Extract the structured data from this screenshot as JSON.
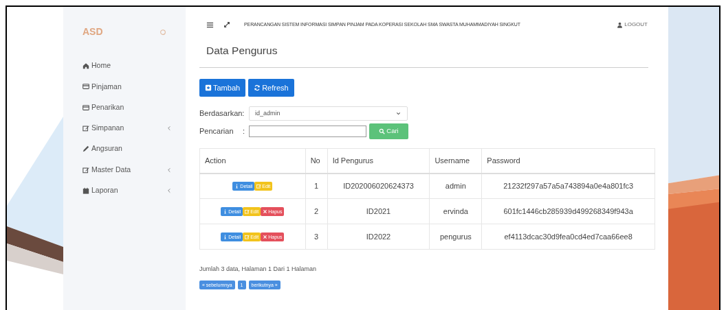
{
  "sidebar": {
    "brand": "ASD",
    "items": [
      {
        "label": "Home",
        "has_submenu": false
      },
      {
        "label": "Pinjaman",
        "has_submenu": false
      },
      {
        "label": "Penarikan",
        "has_submenu": false
      },
      {
        "label": "Simpanan",
        "has_submenu": true
      },
      {
        "label": "Angsuran",
        "has_submenu": false
      },
      {
        "label": "Master Data",
        "has_submenu": true
      },
      {
        "label": "Laporan",
        "has_submenu": true
      }
    ]
  },
  "topbar": {
    "title": "PERANCANGAN SISTEM INFORMASI SIMPAN PINJAM PADA KOPERASI SEKOLAH SMA SWASTA MUHAMMADIYAH SINGKUT",
    "logout": "LOGOUT"
  },
  "page": {
    "heading": "Data Pengurus",
    "toolbar": [
      {
        "kind": "add",
        "label": "Tambah"
      },
      {
        "kind": "refresh",
        "label": "Refresh"
      }
    ],
    "filter": {
      "label": "Berdasarkan:",
      "value": "id_admin"
    },
    "search": {
      "label": "Pencarian",
      "separator": ":",
      "button": "Cari"
    },
    "table": {
      "columns": [
        "Action",
        "No",
        "Id Pengurus",
        "Username",
        "Password"
      ],
      "rows": [
        {
          "actions": [
            {
              "kind": "detail",
              "label": "Detail"
            },
            {
              "kind": "edit",
              "label": "Edit"
            }
          ],
          "no": "1",
          "id": "ID202006020624373",
          "username": "admin",
          "password": "21232f297a57a5a743894a0e4a801fc3"
        },
        {
          "actions": [
            {
              "kind": "detail",
              "label": "Detail"
            },
            {
              "kind": "edit",
              "label": "Edit"
            },
            {
              "kind": "delete",
              "label": "Hapus"
            }
          ],
          "no": "2",
          "id": "ID2021",
          "username": "ervinda",
          "password": "601fc1446cb285939d499268349f943a"
        },
        {
          "actions": [
            {
              "kind": "detail",
              "label": "Detail"
            },
            {
              "kind": "edit",
              "label": "Edit"
            },
            {
              "kind": "delete",
              "label": "Hapus"
            }
          ],
          "no": "3",
          "id": "ID2022",
          "username": "pengurus",
          "password": "ef4113dcac30d9fea0cd4ed7caa66ee8"
        }
      ]
    },
    "summary": "Jumlah 3 data, Halaman 1 Dari 1 Halaman",
    "pagination": [
      "« sebelumnya",
      "1",
      "berikutnya »"
    ]
  }
}
